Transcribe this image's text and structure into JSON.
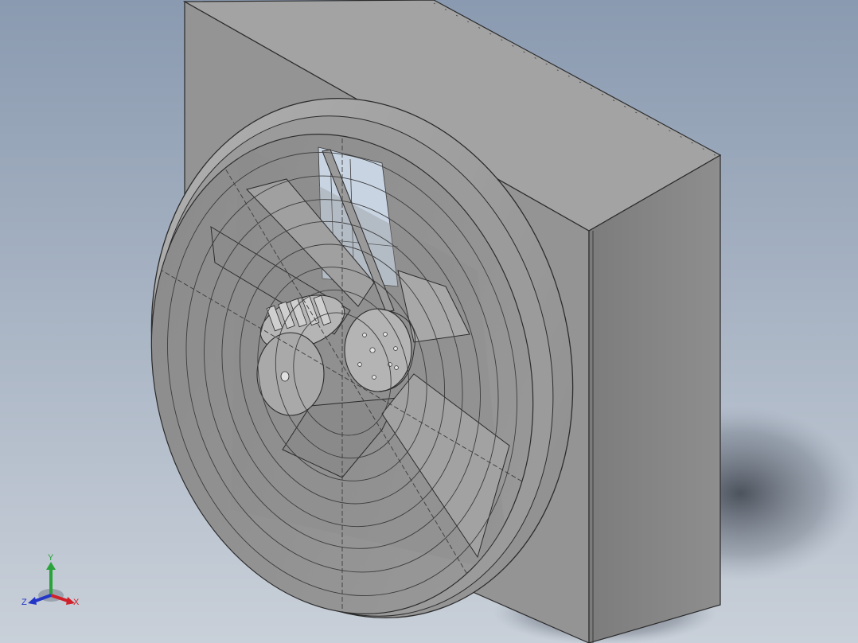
{
  "viewport": {
    "background_top": "#8a9ab0",
    "background_bottom": "#c5ccd6"
  },
  "model": {
    "body_color": "#8e8e8e",
    "light_face_color": "#a6a6a6",
    "dark_face_color": "#6f6f6f",
    "edge_color": "#2b2b2b"
  },
  "triad": {
    "x_label": "X",
    "y_label": "Y",
    "z_label": "Z",
    "x_color": "#d0202a",
    "y_color": "#2aa33a",
    "z_color": "#2436c8"
  }
}
